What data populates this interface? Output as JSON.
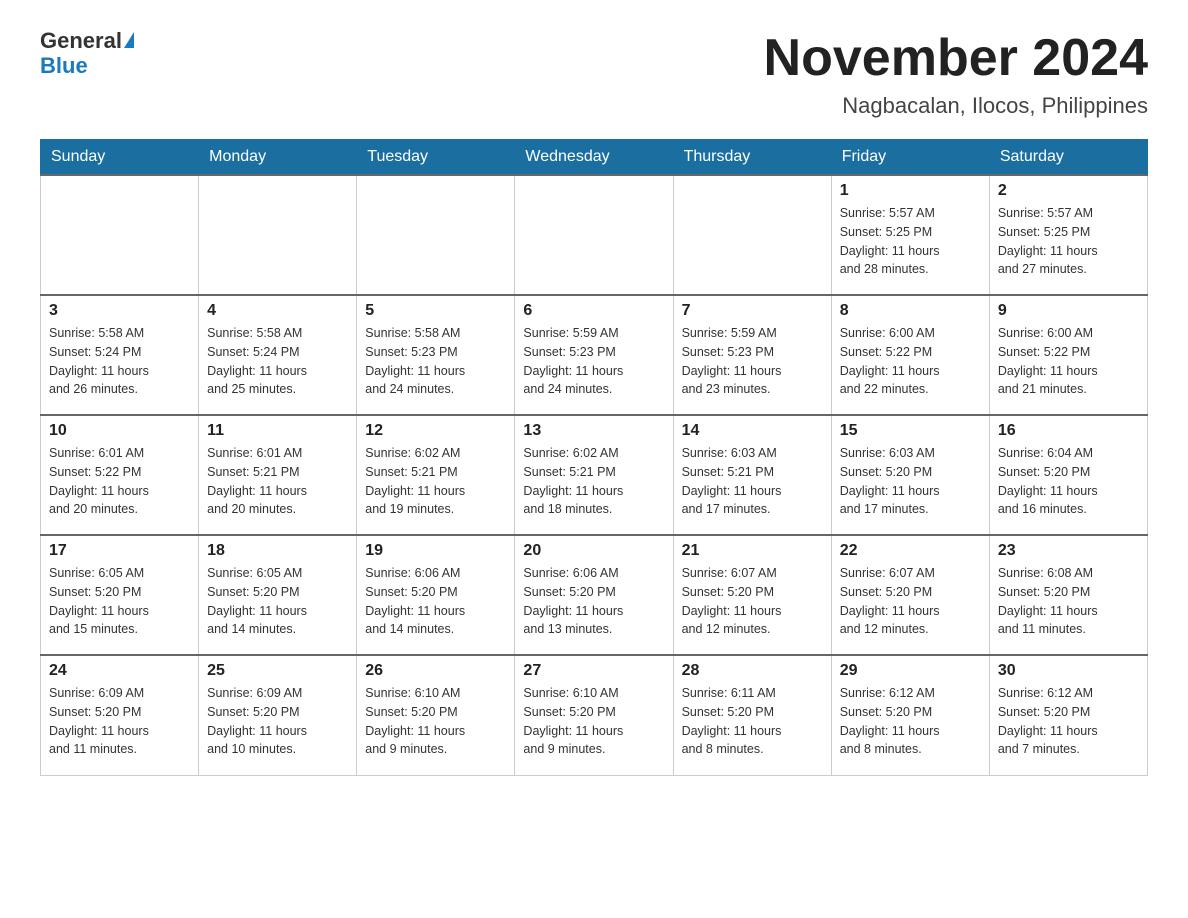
{
  "header": {
    "logo_general": "General",
    "logo_blue": "Blue",
    "month_title": "November 2024",
    "location": "Nagbacalan, Ilocos, Philippines"
  },
  "weekdays": [
    "Sunday",
    "Monday",
    "Tuesday",
    "Wednesday",
    "Thursday",
    "Friday",
    "Saturday"
  ],
  "weeks": [
    [
      {
        "day": "",
        "info": ""
      },
      {
        "day": "",
        "info": ""
      },
      {
        "day": "",
        "info": ""
      },
      {
        "day": "",
        "info": ""
      },
      {
        "day": "",
        "info": ""
      },
      {
        "day": "1",
        "info": "Sunrise: 5:57 AM\nSunset: 5:25 PM\nDaylight: 11 hours\nand 28 minutes."
      },
      {
        "day": "2",
        "info": "Sunrise: 5:57 AM\nSunset: 5:25 PM\nDaylight: 11 hours\nand 27 minutes."
      }
    ],
    [
      {
        "day": "3",
        "info": "Sunrise: 5:58 AM\nSunset: 5:24 PM\nDaylight: 11 hours\nand 26 minutes."
      },
      {
        "day": "4",
        "info": "Sunrise: 5:58 AM\nSunset: 5:24 PM\nDaylight: 11 hours\nand 25 minutes."
      },
      {
        "day": "5",
        "info": "Sunrise: 5:58 AM\nSunset: 5:23 PM\nDaylight: 11 hours\nand 24 minutes."
      },
      {
        "day": "6",
        "info": "Sunrise: 5:59 AM\nSunset: 5:23 PM\nDaylight: 11 hours\nand 24 minutes."
      },
      {
        "day": "7",
        "info": "Sunrise: 5:59 AM\nSunset: 5:23 PM\nDaylight: 11 hours\nand 23 minutes."
      },
      {
        "day": "8",
        "info": "Sunrise: 6:00 AM\nSunset: 5:22 PM\nDaylight: 11 hours\nand 22 minutes."
      },
      {
        "day": "9",
        "info": "Sunrise: 6:00 AM\nSunset: 5:22 PM\nDaylight: 11 hours\nand 21 minutes."
      }
    ],
    [
      {
        "day": "10",
        "info": "Sunrise: 6:01 AM\nSunset: 5:22 PM\nDaylight: 11 hours\nand 20 minutes."
      },
      {
        "day": "11",
        "info": "Sunrise: 6:01 AM\nSunset: 5:21 PM\nDaylight: 11 hours\nand 20 minutes."
      },
      {
        "day": "12",
        "info": "Sunrise: 6:02 AM\nSunset: 5:21 PM\nDaylight: 11 hours\nand 19 minutes."
      },
      {
        "day": "13",
        "info": "Sunrise: 6:02 AM\nSunset: 5:21 PM\nDaylight: 11 hours\nand 18 minutes."
      },
      {
        "day": "14",
        "info": "Sunrise: 6:03 AM\nSunset: 5:21 PM\nDaylight: 11 hours\nand 17 minutes."
      },
      {
        "day": "15",
        "info": "Sunrise: 6:03 AM\nSunset: 5:20 PM\nDaylight: 11 hours\nand 17 minutes."
      },
      {
        "day": "16",
        "info": "Sunrise: 6:04 AM\nSunset: 5:20 PM\nDaylight: 11 hours\nand 16 minutes."
      }
    ],
    [
      {
        "day": "17",
        "info": "Sunrise: 6:05 AM\nSunset: 5:20 PM\nDaylight: 11 hours\nand 15 minutes."
      },
      {
        "day": "18",
        "info": "Sunrise: 6:05 AM\nSunset: 5:20 PM\nDaylight: 11 hours\nand 14 minutes."
      },
      {
        "day": "19",
        "info": "Sunrise: 6:06 AM\nSunset: 5:20 PM\nDaylight: 11 hours\nand 14 minutes."
      },
      {
        "day": "20",
        "info": "Sunrise: 6:06 AM\nSunset: 5:20 PM\nDaylight: 11 hours\nand 13 minutes."
      },
      {
        "day": "21",
        "info": "Sunrise: 6:07 AM\nSunset: 5:20 PM\nDaylight: 11 hours\nand 12 minutes."
      },
      {
        "day": "22",
        "info": "Sunrise: 6:07 AM\nSunset: 5:20 PM\nDaylight: 11 hours\nand 12 minutes."
      },
      {
        "day": "23",
        "info": "Sunrise: 6:08 AM\nSunset: 5:20 PM\nDaylight: 11 hours\nand 11 minutes."
      }
    ],
    [
      {
        "day": "24",
        "info": "Sunrise: 6:09 AM\nSunset: 5:20 PM\nDaylight: 11 hours\nand 11 minutes."
      },
      {
        "day": "25",
        "info": "Sunrise: 6:09 AM\nSunset: 5:20 PM\nDaylight: 11 hours\nand 10 minutes."
      },
      {
        "day": "26",
        "info": "Sunrise: 6:10 AM\nSunset: 5:20 PM\nDaylight: 11 hours\nand 9 minutes."
      },
      {
        "day": "27",
        "info": "Sunrise: 6:10 AM\nSunset: 5:20 PM\nDaylight: 11 hours\nand 9 minutes."
      },
      {
        "day": "28",
        "info": "Sunrise: 6:11 AM\nSunset: 5:20 PM\nDaylight: 11 hours\nand 8 minutes."
      },
      {
        "day": "29",
        "info": "Sunrise: 6:12 AM\nSunset: 5:20 PM\nDaylight: 11 hours\nand 8 minutes."
      },
      {
        "day": "30",
        "info": "Sunrise: 6:12 AM\nSunset: 5:20 PM\nDaylight: 11 hours\nand 7 minutes."
      }
    ]
  ]
}
